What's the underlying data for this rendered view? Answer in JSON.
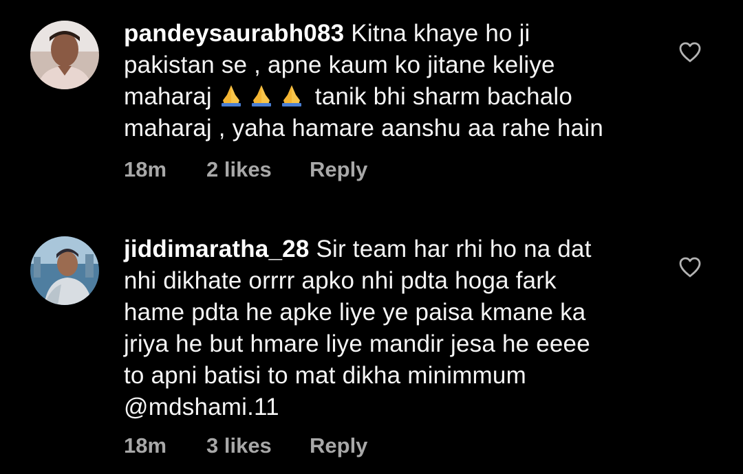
{
  "comments": [
    {
      "username": "pandeysaurabh083",
      "lines": [
        "Kitna khaye ho ji",
        "pakistan se , apne kaum ko jitane keliye",
        "maharaj",
        "tanik bhi sharm bachalo",
        "maharaj , yaha hamare aanshu aa rahe hain"
      ],
      "emoji": "folded-hands-icon",
      "emoji_count": 3,
      "time": "18m",
      "likes": "2 likes",
      "reply_label": "Reply"
    },
    {
      "username": "jiddimaratha_28",
      "lines": [
        "Sir team har rhi ho na dat",
        "nhi dikhate orrrr apko nhi pdta hoga fark",
        "hame pdta he apke liye ye paisa kmane ka",
        "jriya he but hmare liye mandir jesa he eeee",
        "to  apni batisi to mat dikha minimmum",
        "@mdshami.11"
      ],
      "time": "18m",
      "likes": "3 likes",
      "reply_label": "Reply"
    }
  ],
  "icons": {
    "like": "heart-outline-icon",
    "emoji": "folded-hands-icon"
  },
  "colors": {
    "background": "#000000",
    "text": "#f5f5f5",
    "meta": "#a8a8a8",
    "heart": "#b3b3b3"
  }
}
